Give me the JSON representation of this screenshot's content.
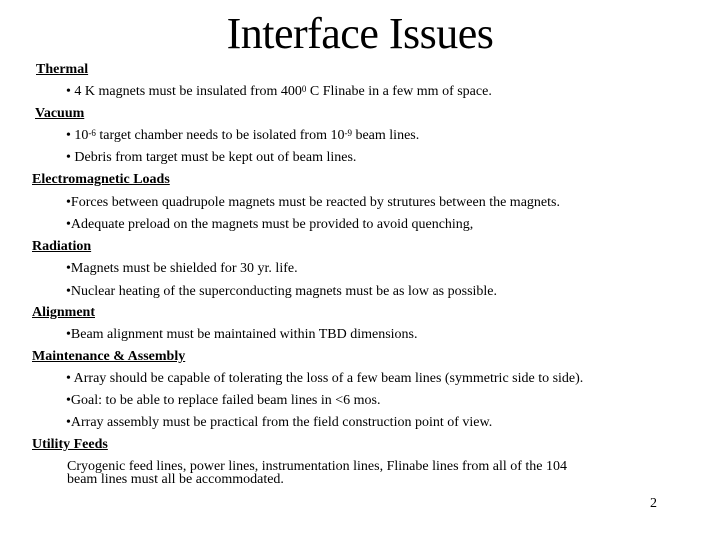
{
  "slide": {
    "title": "Interface Issues",
    "page_number": "2",
    "sections": [
      {
        "heading": "Thermal",
        "items": [
          {
            "pre": "• 4 K magnets must be insulated from 400",
            "sup": "0",
            "post": " C Flinabe in a few mm of space."
          }
        ]
      },
      {
        "heading": "Vacuum",
        "items": [
          {
            "pre": "• 10",
            "sup": "-6",
            "mid": " target chamber needs to be isolated from 10",
            "sup2": "-9",
            "post": " beam lines."
          },
          {
            "text": "• Debris from target must be kept out of beam lines."
          }
        ]
      },
      {
        "heading": "Electromagnetic Loads",
        "items": [
          {
            "text": "•Forces between quadrupole magnets must be reacted by strutures between the magnets."
          },
          {
            "text": "•Adequate preload on the magnets must be provided to avoid quenching,"
          }
        ]
      },
      {
        "heading": "Radiation",
        "items": [
          {
            "text": "•Magnets must be shielded for 30 yr. life."
          },
          {
            "text": "•Nuclear heating of the superconducting magnets must be as low as possible."
          }
        ]
      },
      {
        "heading": "Alignment",
        "items": [
          {
            "text": "•Beam alignment must be maintained within  TBD dimensions."
          }
        ]
      },
      {
        "heading": "Maintenance & Assembly",
        "items": [
          {
            "text": "• Array should be capable of tolerating the loss of a few beam lines (symmetric side to side)."
          },
          {
            "text": "•Goal:  to be able to replace failed beam lines in <6 mos."
          },
          {
            "text": "•Array assembly must be practical from the field construction point of view."
          }
        ]
      },
      {
        "heading": "Utility Feeds",
        "paragraph_line1": " Cryogenic feed lines, power lines, instrumentation lines, Flinabe lines from all of the 104",
        "paragraph_line2": "beam lines  must all be accommodated."
      }
    ]
  }
}
